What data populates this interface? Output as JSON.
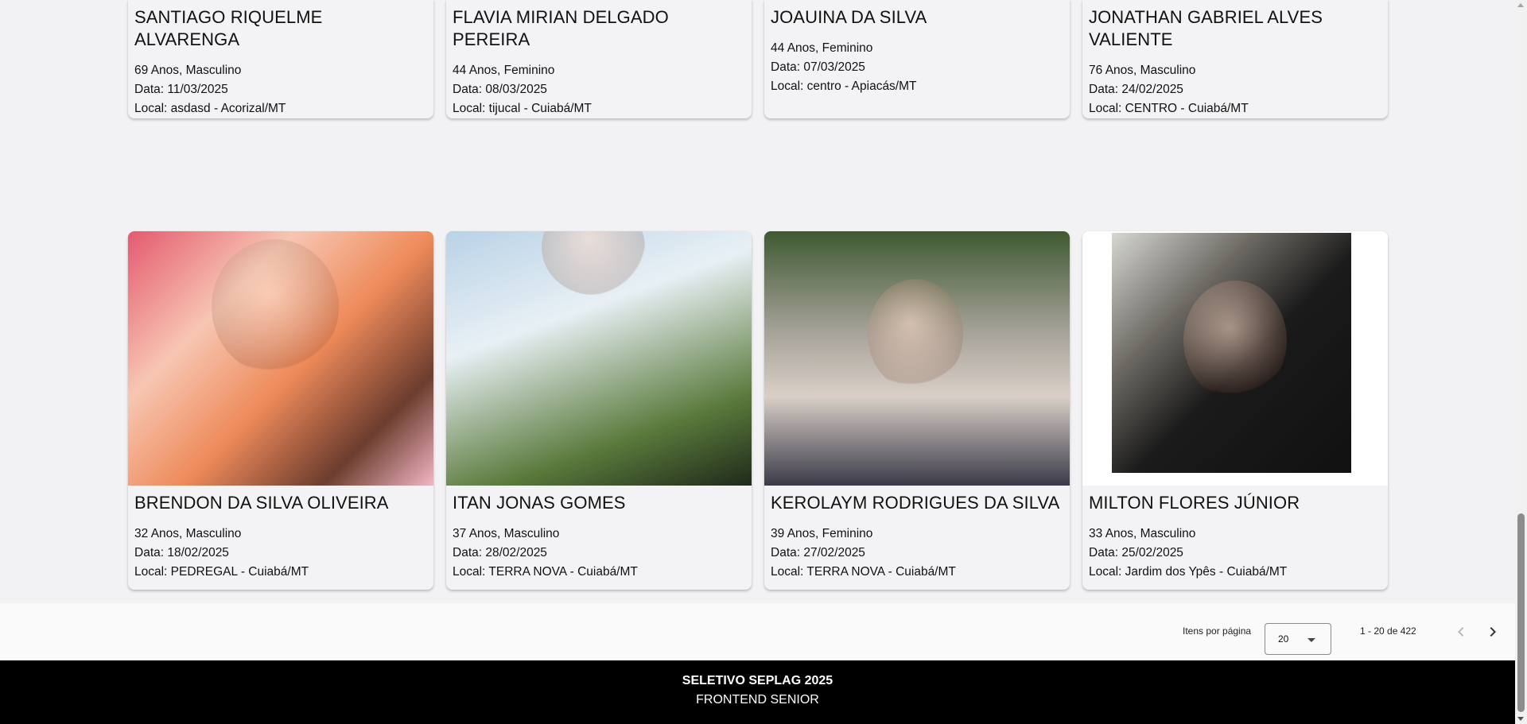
{
  "cards_row1": [
    {
      "name": "SANTIAGO RIQUELME ALVARENGA",
      "age_gender": "69 Anos, Masculino",
      "date": "Data: 11/03/2025",
      "location": "Local: asdasd - Acorizal/MT"
    },
    {
      "name": "FLAVIA MIRIAN DELGADO PEREIRA",
      "age_gender": "44 Anos, Feminino",
      "date": "Data: 08/03/2025",
      "location": "Local: tijucal - Cuiabá/MT"
    },
    {
      "name": "JOAUINA DA SILVA",
      "age_gender": "44 Anos, Feminino",
      "date": "Data: 07/03/2025",
      "location": "Local: centro - Apiacás/MT"
    },
    {
      "name": "JONATHAN GABRIEL ALVES VALIENTE",
      "age_gender": "76 Anos, Masculino",
      "date": "Data: 24/02/2025",
      "location": "Local: CENTRO - Cuiabá/MT"
    }
  ],
  "cards_row2": [
    {
      "name": "BRENDON DA SILVA OLIVEIRA",
      "age_gender": "32 Anos, Masculino",
      "date": "Data: 18/02/2025",
      "location": "Local: PEDREGAL - Cuiabá/MT"
    },
    {
      "name": "ITAN JONAS GOMES",
      "age_gender": "37 Anos, Masculino",
      "date": "Data: 28/02/2025",
      "location": "Local: TERRA NOVA - Cuiabá/MT"
    },
    {
      "name": "KEROLAYM RODRIGUES DA SILVA",
      "age_gender": "39 Anos, Feminino",
      "date": "Data: 27/02/2025",
      "location": "Local: TERRA NOVA - Cuiabá/MT"
    },
    {
      "name": "MILTON FLORES JÚNIOR",
      "age_gender": "33 Anos, Masculino",
      "date": "Data: 25/02/2025",
      "location": "Local: Jardim dos Ypês - Cuiabá/MT"
    }
  ],
  "paginator": {
    "items_per_page_label": "Itens por página",
    "items_per_page_value": "20",
    "range_label": "1 - 20 de 422",
    "prev_icon": "chevron-left-icon",
    "next_icon": "chevron-right-icon"
  },
  "footer": {
    "title": "SELETIVO SEPLAG 2025",
    "subtitle": "FRONTEND SENIOR"
  }
}
